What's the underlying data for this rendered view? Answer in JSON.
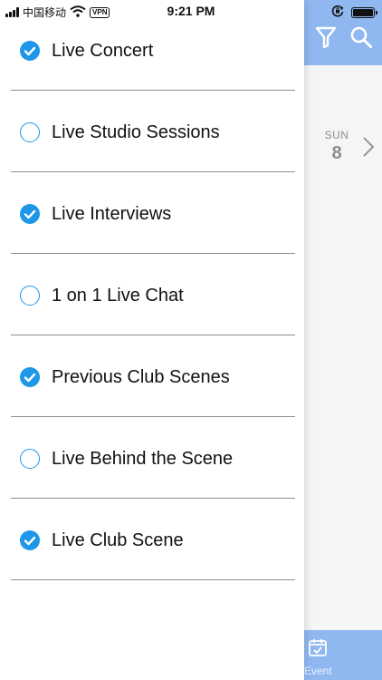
{
  "status_bar": {
    "carrier": "中国移动",
    "vpn": "VPN",
    "time": "9:21 PM"
  },
  "background": {
    "date_day": "SUN",
    "date_number": "8",
    "footer_label": "Event"
  },
  "filter_list": {
    "items": [
      {
        "label": "Live Concert",
        "checked": true
      },
      {
        "label": "Live Studio Sessions",
        "checked": false
      },
      {
        "label": "Live Interviews",
        "checked": true
      },
      {
        "label": "1 on 1 Live Chat",
        "checked": false
      },
      {
        "label": "Previous Club Scenes",
        "checked": true
      },
      {
        "label": "Live Behind the Scene",
        "checked": false
      },
      {
        "label": "Live Club Scene",
        "checked": true
      }
    ]
  },
  "colors": {
    "accent": "#1e97e8",
    "header_bg": "#90b8f0",
    "divider": "#8f8f8f",
    "muted_text": "#8d8d8d"
  },
  "icons": {
    "filter": "filter-icon",
    "search": "search-icon",
    "chevron": "chevron-right-icon",
    "calendar": "calendar-check-icon"
  }
}
